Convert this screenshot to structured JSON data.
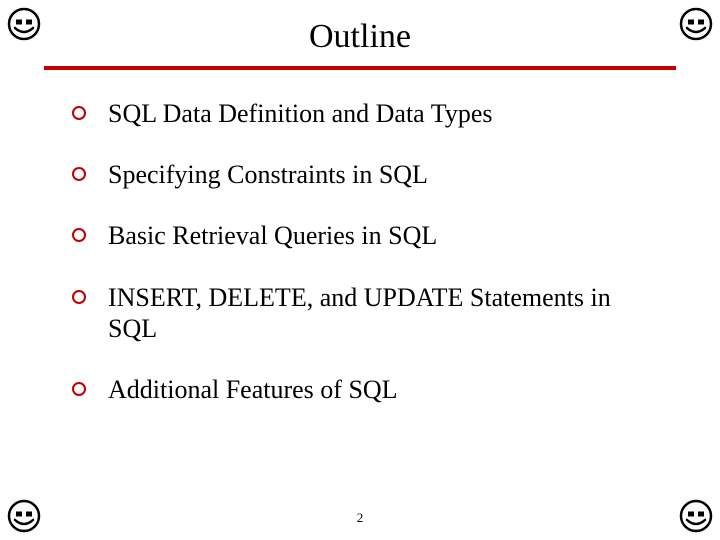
{
  "title": "Outline",
  "bullets": [
    "SQL Data Definition and Data Types",
    "Specifying Constraints in SQL",
    "Basic Retrieval Queries in SQL",
    "INSERT, DELETE, and UPDATE Statements in SQL",
    "Additional Features of SQL"
  ],
  "page_number": "2",
  "colors": {
    "accent": "#c00000"
  }
}
